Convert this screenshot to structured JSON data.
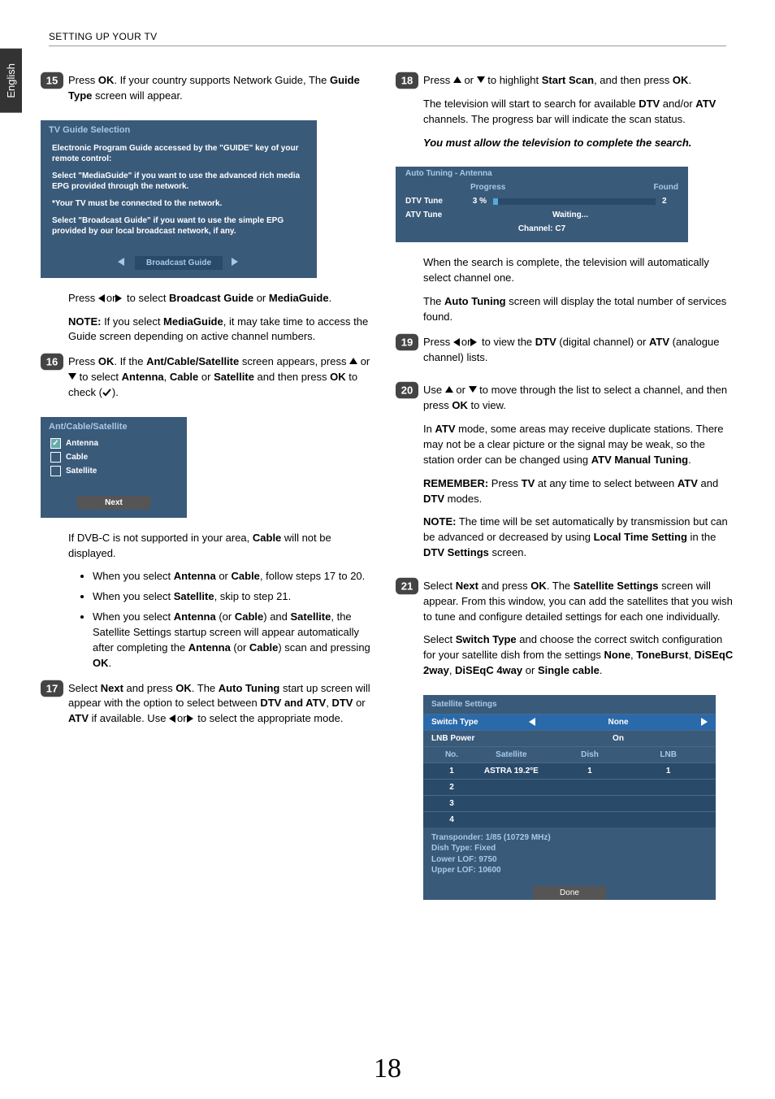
{
  "sideTab": "English",
  "header": "SETTING UP YOUR TV",
  "pageNumber": "18",
  "left": {
    "step15": {
      "num": "15",
      "p1a": "Press ",
      "p1b": "OK",
      "p1c": ". If your country supports Network Guide, The ",
      "p1d": "Guide Type",
      "p1e": " screen will appear.",
      "osdTitle": "TV Guide Selection",
      "osdL1": "Electronic Program Guide accessed by the \"GUIDE\" key of your remote control:",
      "osdL2": "Select \"MediaGuide\" if you want to use the advanced rich media EPG provided through the network.",
      "osdL3": "*Your TV must be connected to the network.",
      "osdL4": "Select \"Broadcast Guide\" if you want to use the simple EPG provided by our local broadcast network, if any.",
      "osdBtn": "Broadcast Guide",
      "p2a": "Press ",
      "p2b": "or",
      "p2c": " to select ",
      "p2d": "Broadcast Guide",
      "p2e": " or ",
      "p2f": "MediaGuide",
      "p2g": ".",
      "noteLabel": "NOTE:",
      "noteA": " If you select ",
      "noteB": "MediaGuide",
      "noteC": ", it may take time to access the Guide screen depending on active channel numbers."
    },
    "step16": {
      "num": "16",
      "p1a": "Press ",
      "p1b": "OK",
      "p1c": ". If the ",
      "p1d": "Ant/Cable/Satellite",
      "p1e": " screen appears, press ",
      "p1f": " or ",
      "p1g": " to select ",
      "p1h": "Antenna",
      "p1i": ", ",
      "p1j": "Cable",
      "p1k": " or ",
      "p1l": "Satellite",
      "p1m": " and then press ",
      "p1n": "OK",
      "p1o": " to check (",
      "p1p": ").",
      "osdTitle": "Ant/Cable/Satellite",
      "opt1": "Antenna",
      "opt2": "Cable",
      "opt3": "Satellite",
      "nextBtn": "Next",
      "p2a": "If DVB-C is not supported in your area, ",
      "p2b": "Cable",
      "p2c": " will not be displayed.",
      "b1a": "When you select ",
      "b1b": "Antenna",
      "b1c": " or ",
      "b1d": "Cable",
      "b1e": ", follow steps 17 to 20.",
      "b2a": "When you select ",
      "b2b": "Satellite",
      "b2c": ", skip to step 21.",
      "b3a": "When you select ",
      "b3b": "Antenna",
      "b3c": " (or ",
      "b3d": "Cable",
      "b3e": ") and ",
      "b3f": "Satellite",
      "b3g": ", the Satellite Settings startup screen will appear automatically after completing the ",
      "b3h": "Antenna",
      "b3i": " (or ",
      "b3j": "Cable",
      "b3k": ") scan and pressing ",
      "b3l": "OK",
      "b3m": "."
    },
    "step17": {
      "num": "17",
      "p1a": "Select ",
      "p1b": "Next",
      "p1c": " and press ",
      "p1d": "OK",
      "p1e": ". The ",
      "p1f": "Auto Tuning",
      "p1g": " start up screen will appear with the option to select between ",
      "p1h": "DTV and ATV",
      "p1i": ", ",
      "p1j": "DTV",
      "p1k": " or ",
      "p1l": "ATV",
      "p1m": " if available. Use ",
      "p1n": "or",
      "p1o": " to select the appropriate mode."
    }
  },
  "right": {
    "step18": {
      "num": "18",
      "p1a": "Press ",
      "p1b": " or ",
      "p1c": " to highlight ",
      "p1d": "Start Scan",
      "p1e": ", and then press ",
      "p1f": "OK",
      "p1g": ".",
      "p2a": "The television will start to search for available ",
      "p2b": "DTV",
      "p2c": " and/or ",
      "p2d": "ATV",
      "p2e": " channels. The progress bar will indicate the scan status.",
      "p3": "You must allow the television to complete the search.",
      "osdTitle": "Auto Tuning - Antenna",
      "osdProg": "Progress",
      "osdFound": "Found",
      "osdDtv": "DTV Tune",
      "osdDtvPct": "3 %",
      "osdDtvF": "2",
      "osdAtv": "ATV Tune",
      "osdWait": "Waiting...",
      "osdChan": "Channel: C7",
      "p4": "When the search is complete, the television will automatically select channel one.",
      "p5a": "The ",
      "p5b": "Auto Tuning",
      "p5c": " screen will display the total number of services found."
    },
    "step19": {
      "num": "19",
      "p1a": "Press ",
      "p1b": "or",
      "p1c": " to view the ",
      "p1d": "DTV",
      "p1e": " (digital channel) or ",
      "p1f": "ATV",
      "p1g": " (analogue channel) lists."
    },
    "step20": {
      "num": "20",
      "p1a": "Use ",
      "p1b": " or ",
      "p1c": " to move through the list to select a channel, and then press ",
      "p1d": "OK",
      "p1e": " to view.",
      "p2a": "In ",
      "p2b": "ATV",
      "p2c": " mode, some areas may receive duplicate stations. There may not be a clear picture or the signal may be weak, so the station order can be changed using ",
      "p2d": "ATV Manual Tuning",
      "p2e": ".",
      "p3a": "REMEMBER:",
      "p3b": " Press ",
      "p3c": "TV",
      "p3d": " at any time to select between ",
      "p3e": "ATV",
      "p3f": " and ",
      "p3g": "DTV",
      "p3h": " modes.",
      "p4a": "NOTE:",
      "p4b": " The time will be set automatically by transmission but can be advanced or decreased by using ",
      "p4c": "Local Time Setting",
      "p4d": " in the ",
      "p4e": "DTV Settings",
      "p4f": " screen."
    },
    "step21": {
      "num": "21",
      "p1a": "Select ",
      "p1b": "Next",
      "p1c": " and press ",
      "p1d": "OK",
      "p1e": ". The ",
      "p1f": "Satellite Settings",
      "p1g": " screen will appear. From this window, you can add the satellites that you wish to tune and configure detailed settings for each one individually.",
      "p2a": "Select ",
      "p2b": "Switch Type",
      "p2c": " and choose the correct switch configuration for your satellite dish from the settings ",
      "p2d": "None",
      "p2e": ", ",
      "p2f": "ToneBurst",
      "p2g": ", ",
      "p2h": "DiSEqC 2way",
      "p2i": ", ",
      "p2j": "DiSEqC 4way",
      "p2k": " or ",
      "p2l": "Single cable",
      "p2m": ".",
      "tbl": {
        "title": "Satellite Settings",
        "r1l": "Switch Type",
        "r1v": "None",
        "r2l": "LNB Power",
        "r2v": "On",
        "hNo": "No.",
        "hSat": "Satellite",
        "hDish": "Dish",
        "hLnb": "LNB",
        "d1n": "1",
        "d1s": "ASTRA 19.2°E",
        "d1d": "1",
        "d1l": "1",
        "d2n": "2",
        "d3n": "3",
        "d4n": "4",
        "info1": "Transponder: 1/85 (10729 MHz)",
        "info2": "Dish Type: Fixed",
        "info3": "Lower LOF: 9750",
        "info4": "Upper LOF: 10600",
        "done": "Done"
      }
    }
  }
}
